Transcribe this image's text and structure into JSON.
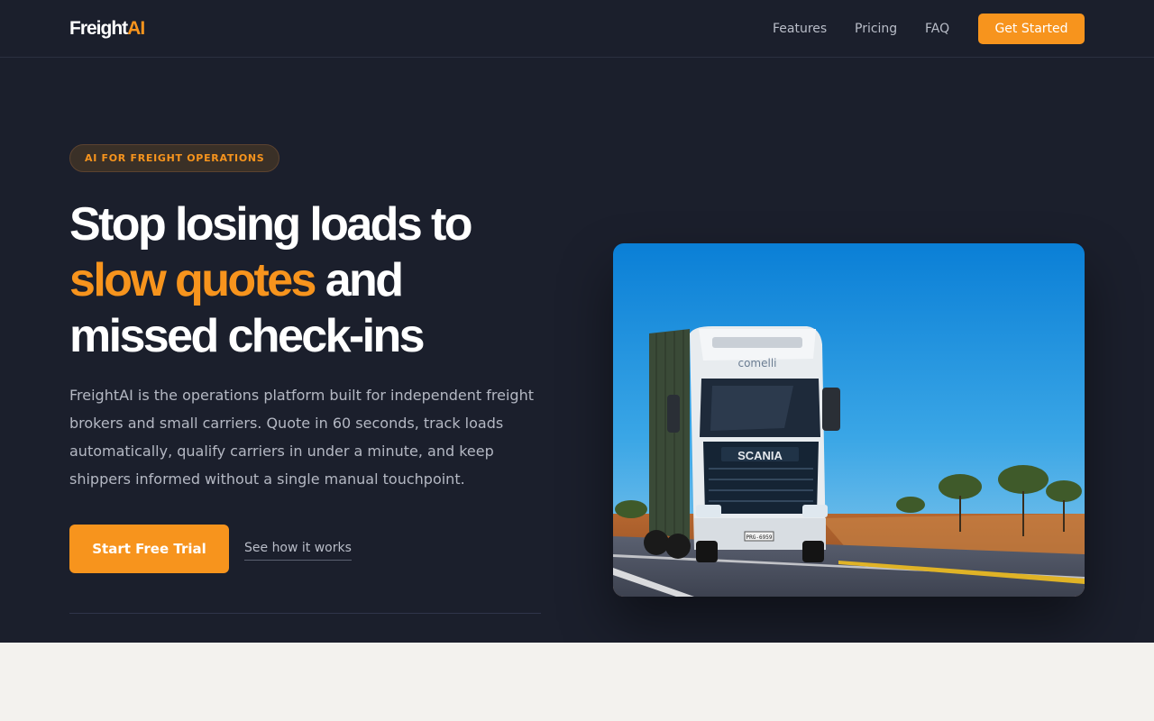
{
  "brand": {
    "name_main": "Freight",
    "name_accent": "AI"
  },
  "nav": {
    "links": [
      "Features",
      "Pricing",
      "FAQ"
    ],
    "cta_label": "Get Started"
  },
  "hero": {
    "badge": "AI FOR FREIGHT OPERATIONS",
    "headline": {
      "line1": "Stop losing loads to",
      "highlight": "slow quotes",
      "line2_rest": " and",
      "line3": "missed check-ins"
    },
    "description": "FreightAI is the operations platform built for independent freight brokers and small carriers. Quote in 60 seconds, track loads automatically, qualify carriers in under a minute, and keep shippers informed without a single manual touchpoint.",
    "primary_cta": "Start Free Trial",
    "secondary_cta": "See how it works",
    "image": {
      "truck_brand": "SCANIA",
      "cab_text": "comelli",
      "plate": "PRG-6959"
    }
  },
  "colors": {
    "background": "#1b1f2c",
    "accent": "#f7941d",
    "text_primary": "#ffffff",
    "text_muted": "#b4b8c3",
    "lower_section": "#f3f2ee"
  }
}
